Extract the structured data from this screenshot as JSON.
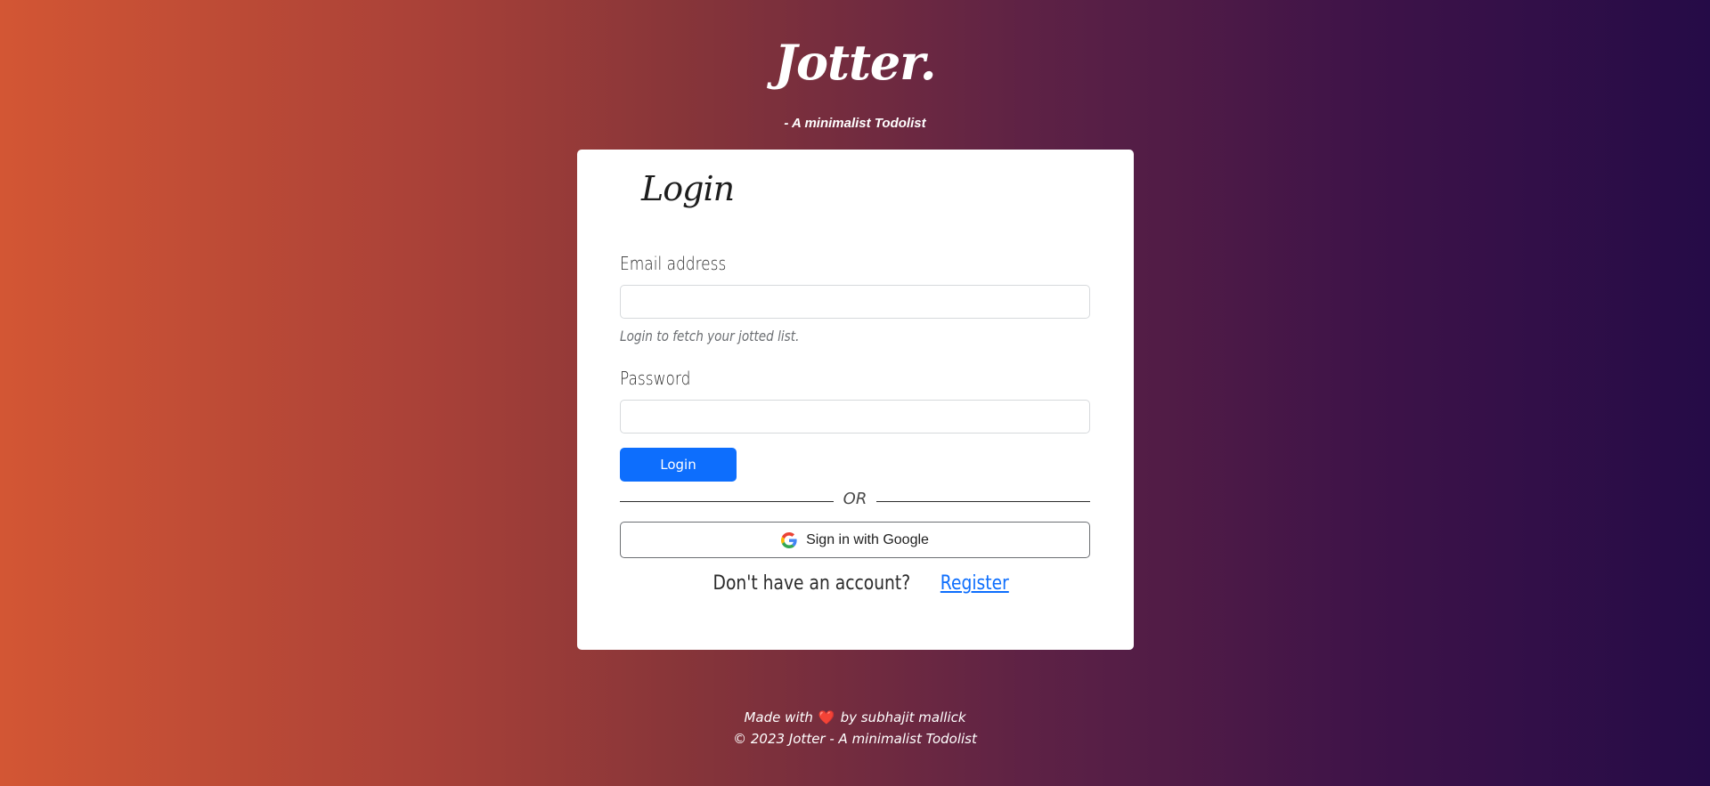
{
  "header": {
    "brand": "Jotter.",
    "tagline": "- A minimalist Todolist"
  },
  "login_card": {
    "title": "Login",
    "email": {
      "label": "Email address",
      "value": "",
      "placeholder": "",
      "help_text": "Login to fetch your jotted list."
    },
    "password": {
      "label": "Password",
      "value": "",
      "placeholder": ""
    },
    "login_button": "Login",
    "separator": "OR",
    "google_button": "Sign in with Google",
    "register_prompt": "Don't have an account?",
    "register_link": "Register"
  },
  "footer": {
    "made_with": "Made with",
    "heart": "❤️",
    "by": "by subhajit mallick",
    "copyright": "© 2023 Jotter - A minimalist Todolist"
  },
  "colors": {
    "accent": "#0d6efd",
    "heart": "#ff2b2b",
    "card": "#ffffff"
  },
  "icons": {
    "google": "google-g-icon",
    "heart": "heart-icon"
  }
}
